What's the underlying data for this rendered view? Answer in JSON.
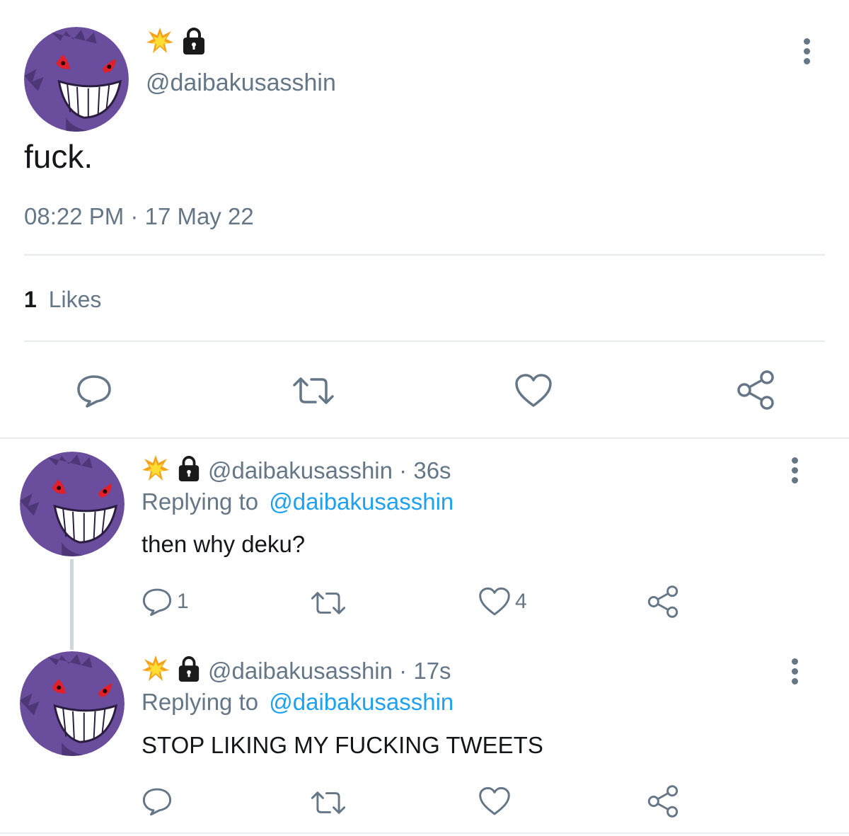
{
  "main_tweet": {
    "handle": "@daibakusasshin",
    "text": "fuck.",
    "time": "08:22 PM",
    "sep": "·",
    "date": "17 May 22",
    "likes_count": "1",
    "likes_label": "Likes",
    "badges": [
      "explosion-emoji",
      "lock-icon"
    ]
  },
  "replies": [
    {
      "handle": "@daibakusasshin",
      "sep": "·",
      "age": "36s",
      "replying_label": "Replying to",
      "replying_handle": "@daibakusasshin",
      "text": "then why deku?",
      "reply_count": "1",
      "like_count": "4"
    },
    {
      "handle": "@daibakusasshin",
      "sep": "·",
      "age": "17s",
      "replying_label": "Replying to",
      "replying_handle": "@daibakusasshin",
      "text": "STOP LIKING MY FUCKING TWEETS"
    }
  ],
  "colors": {
    "icon": "#657786",
    "link": "#1da1f2",
    "divider": "#e6ecf0",
    "avatar_purple": "#6b4d9e"
  }
}
